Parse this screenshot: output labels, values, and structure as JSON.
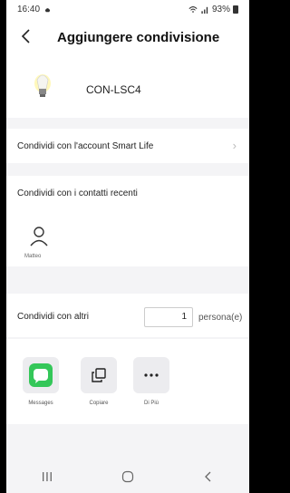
{
  "status": {
    "time": "16:40",
    "signal": "93%"
  },
  "header": {
    "title": "Aggiungere condivisione",
    "back_icon": "chevron-left-icon"
  },
  "device": {
    "name": "CON-LSC4",
    "icon": "lightbulb-icon"
  },
  "share_account": {
    "label": "Condividi con l'account Smart Life"
  },
  "recent": {
    "label": "Condividi con i contatti recenti",
    "contacts": [
      {
        "name": "Matteo"
      }
    ]
  },
  "others": {
    "label": "Condividi con altri",
    "count": "1",
    "unit": "persona(e)"
  },
  "share_options": [
    {
      "label": "Messages",
      "icon": "messages-icon",
      "accent": "#34c759"
    },
    {
      "label": "Copiare",
      "icon": "copy-icon"
    },
    {
      "label": "Di Più",
      "icon": "more-icon"
    }
  ],
  "nav": {
    "recents_icon": "recents-icon",
    "home_icon": "home-icon",
    "back_icon": "back-icon"
  }
}
